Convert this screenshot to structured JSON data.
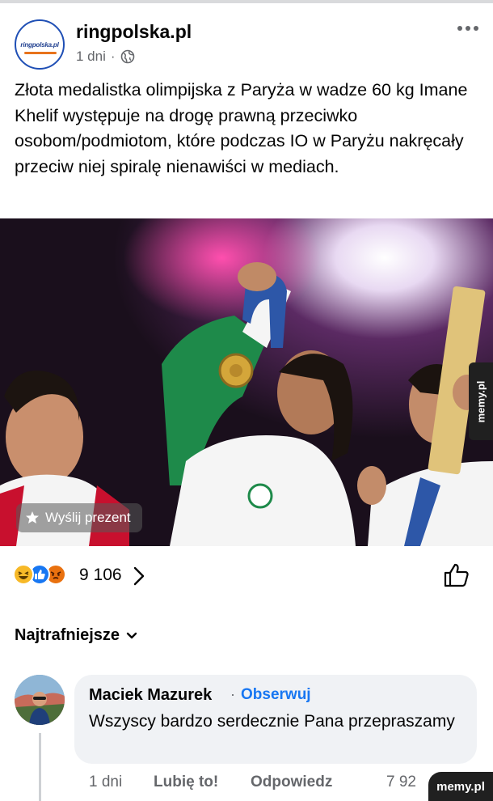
{
  "post": {
    "page_name": "ringpolska.pl",
    "avatar_logo_text": "ringpolska.pl",
    "time": "1 dni",
    "separator": "·",
    "privacy_icon": "globe-icon",
    "text": "Złota medalistka olimpijska z Paryża w wadze 60 kg Imane Khelif występuje na drogę prawną przeciwko osobom/podmiotom, które podczas IO w Paryżu nakręcały przeciw niej spiralę nienawiści  w mediach.",
    "gift_button": "Wyślij prezent"
  },
  "reactions": {
    "icons": [
      "haha-icon",
      "like-icon",
      "angry-icon"
    ],
    "count": "9 106"
  },
  "comments": {
    "sort_label": "Najtrafniejsze",
    "items": [
      {
        "author": "Maciek Mazurek",
        "separator": "·",
        "follow_label": "Obserwuj",
        "text": "Wszyscy bardzo serdecznie Pana przepraszamy",
        "time": "1 dni",
        "like_label": "Lubię to!",
        "reply_label": "Odpowiedz",
        "reaction_count": "7 92"
      }
    ]
  },
  "watermarks": {
    "side": "memy.pl",
    "bottom": "memy.pl"
  },
  "colors": {
    "accent": "#1877f2",
    "secondary_text": "#65676b",
    "bubble": "#f0f2f5"
  }
}
